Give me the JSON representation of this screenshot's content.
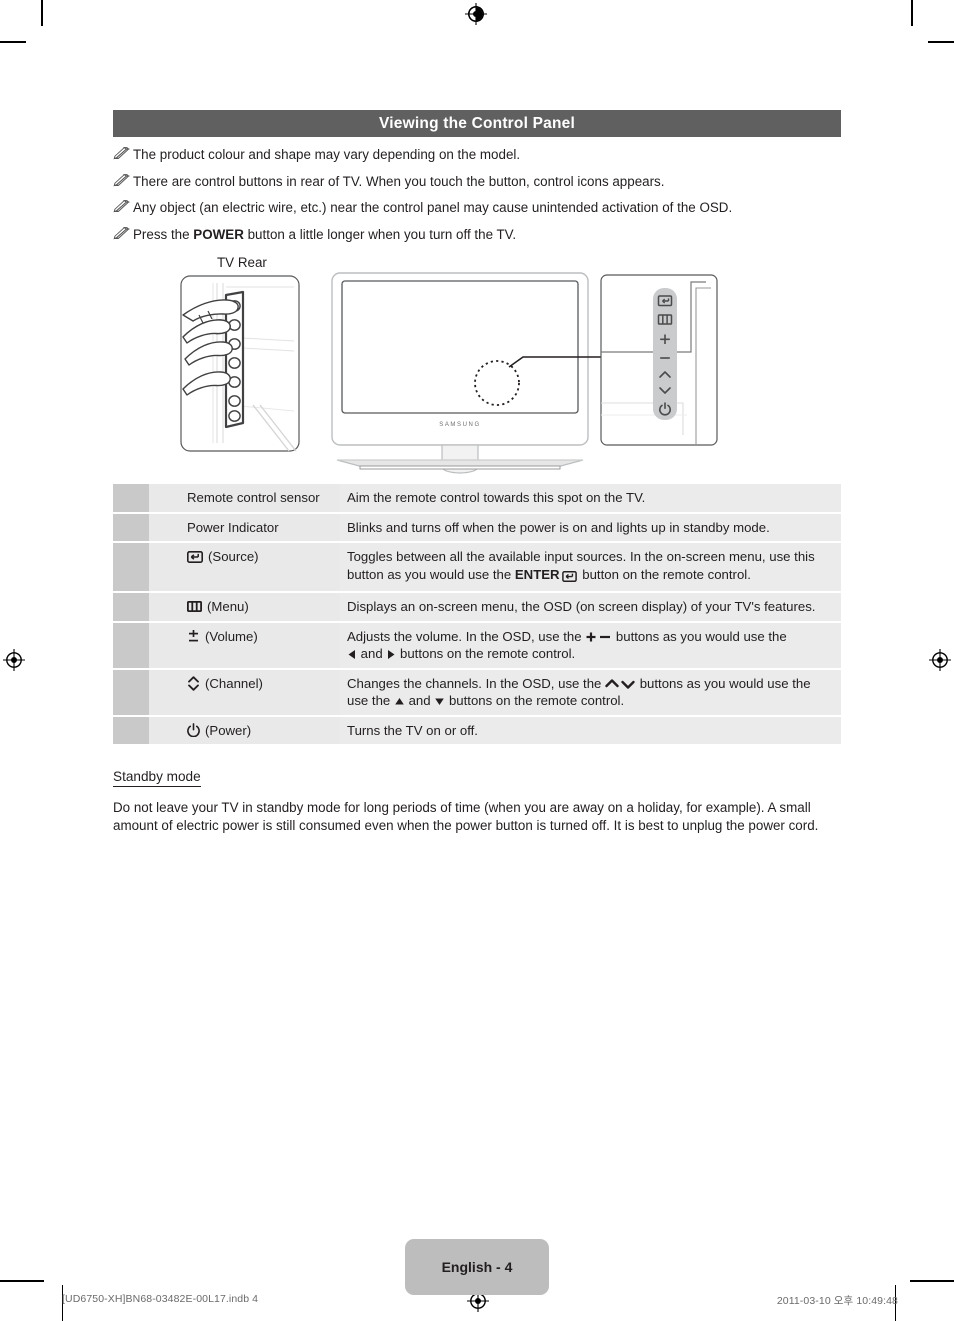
{
  "header": {
    "title": "Viewing the Control Panel"
  },
  "notes": [
    {
      "text": "The product colour and shape may vary depending on the model."
    },
    {
      "text": "There are control buttons in rear of TV. When you touch the button, control icons appears."
    },
    {
      "text": "Any object (an electric wire, etc.) near the control panel may cause unintended activation of the OSD."
    },
    {
      "pre": "Press the ",
      "bold": "POWER",
      "post": " button a little longer when you turn off the TV."
    }
  ],
  "illustration": {
    "rear_label": "TV Rear",
    "brand_text": "SAMSUNG",
    "panel_icons": [
      "source-icon",
      "menu-icon",
      "plus-icon",
      "minus-icon",
      "chevron-up-icon",
      "chevron-down-icon",
      "power-icon"
    ]
  },
  "table": {
    "rows": [
      {
        "icon": "none",
        "label": "Remote control sensor",
        "desc": "Aim the remote control towards this spot on the TV."
      },
      {
        "icon": "none",
        "label": "Power Indicator",
        "desc": "Blinks and turns off when the power is on and lights up in standby mode."
      },
      {
        "icon": "source-icon",
        "label": "(Source)",
        "desc_pre": "Toggles between all the available input sources. In the on-screen menu, use this button as you would use the ",
        "desc_bold": "ENTER",
        "desc_icon": "enter-icon",
        "desc_post": " button on the remote control."
      },
      {
        "icon": "menu-icon",
        "label": "(Menu)",
        "desc": "Displays an on-screen menu, the OSD (on screen display) of your TV's features."
      },
      {
        "icon": "volume-icon",
        "label": "(Volume)",
        "desc_pre": "Adjusts the volume. In the OSD, use the ",
        "desc_icons_1": "plus-minus-icons",
        "desc_mid": " buttons as you would use the ",
        "desc_icons_2": "left-right-triangle-icons",
        "desc_post": " buttons on the remote control."
      },
      {
        "icon": "channel-icon",
        "label": "(Channel)",
        "desc_pre": "Changes the channels. In the OSD, use the ",
        "desc_icons_1": "chevron-up-down-icons",
        "desc_mid": " buttons as you would use the ",
        "desc_icons_2": "up-down-triangle-icons",
        "desc_post": " buttons on the remote control."
      },
      {
        "icon": "power-icon",
        "label": "(Power)",
        "desc": "Turns the TV on or off."
      }
    ]
  },
  "standby": {
    "heading": "Standby mode",
    "body": "Do not leave your TV in standby mode for long periods of time (when you are away on a holiday, for example). A small amount of electric power is still consumed even when the power button is turned off. It is best to unplug the power cord."
  },
  "footer": {
    "page_badge": "English - 4",
    "file_name": "[UD6750-XH]BN68-03482E-00L17.indb   4",
    "timestamp": "2011-03-10   오후 10:49:48"
  },
  "colors": {
    "title_bar": "#616060",
    "swatch_col": "#c9c9c9",
    "label_col": "#e9e9e9",
    "desc_col": "#ebebeb",
    "badge": "#bdbdbd"
  }
}
